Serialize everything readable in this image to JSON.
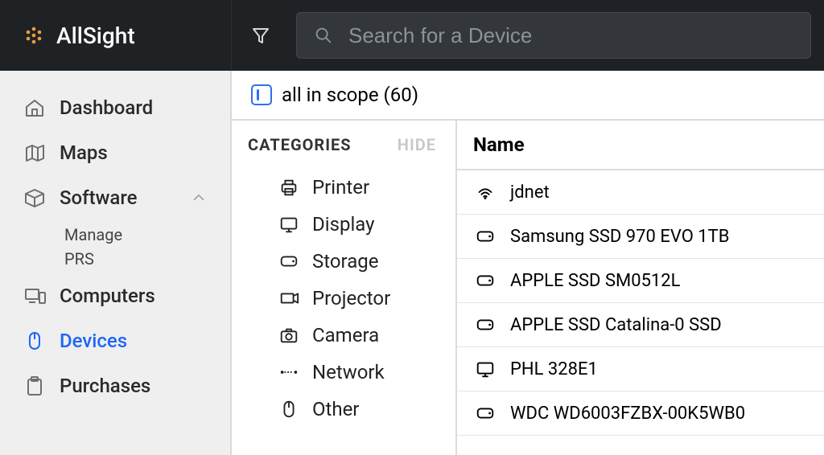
{
  "brand": {
    "name": "AllSight"
  },
  "search": {
    "placeholder": "Search for a Device"
  },
  "sidebar": {
    "items": [
      {
        "label": "Dashboard",
        "icon": "home"
      },
      {
        "label": "Maps",
        "icon": "map"
      },
      {
        "label": "Software",
        "icon": "box",
        "expanded": true,
        "children": [
          {
            "label": "Manage"
          },
          {
            "label": "PRS"
          }
        ]
      },
      {
        "label": "Computers",
        "icon": "computers"
      },
      {
        "label": "Devices",
        "icon": "mouse",
        "active": true
      },
      {
        "label": "Purchases",
        "icon": "clipboard"
      }
    ]
  },
  "scope": {
    "label": "all in scope (60)"
  },
  "categories": {
    "title": "CATEGORIES",
    "hide_label": "HIDE",
    "items": [
      {
        "label": "Printer",
        "icon": "printer"
      },
      {
        "label": "Display",
        "icon": "display"
      },
      {
        "label": "Storage",
        "icon": "storage"
      },
      {
        "label": "Projector",
        "icon": "projector"
      },
      {
        "label": "Camera",
        "icon": "camera"
      },
      {
        "label": "Network",
        "icon": "network"
      },
      {
        "label": "Other",
        "icon": "mouse"
      }
    ]
  },
  "device_list": {
    "header": "Name",
    "rows": [
      {
        "name": "jdnet",
        "icon": "wifi"
      },
      {
        "name": "Samsung SSD 970 EVO 1TB",
        "icon": "storage"
      },
      {
        "name": "APPLE SSD SM0512L",
        "icon": "storage"
      },
      {
        "name": "APPLE SSD Catalina-0 SSD",
        "icon": "storage"
      },
      {
        "name": "PHL 328E1",
        "icon": "display"
      },
      {
        "name": "WDC WD6003FZBX-00K5WB0",
        "icon": "storage"
      }
    ]
  }
}
